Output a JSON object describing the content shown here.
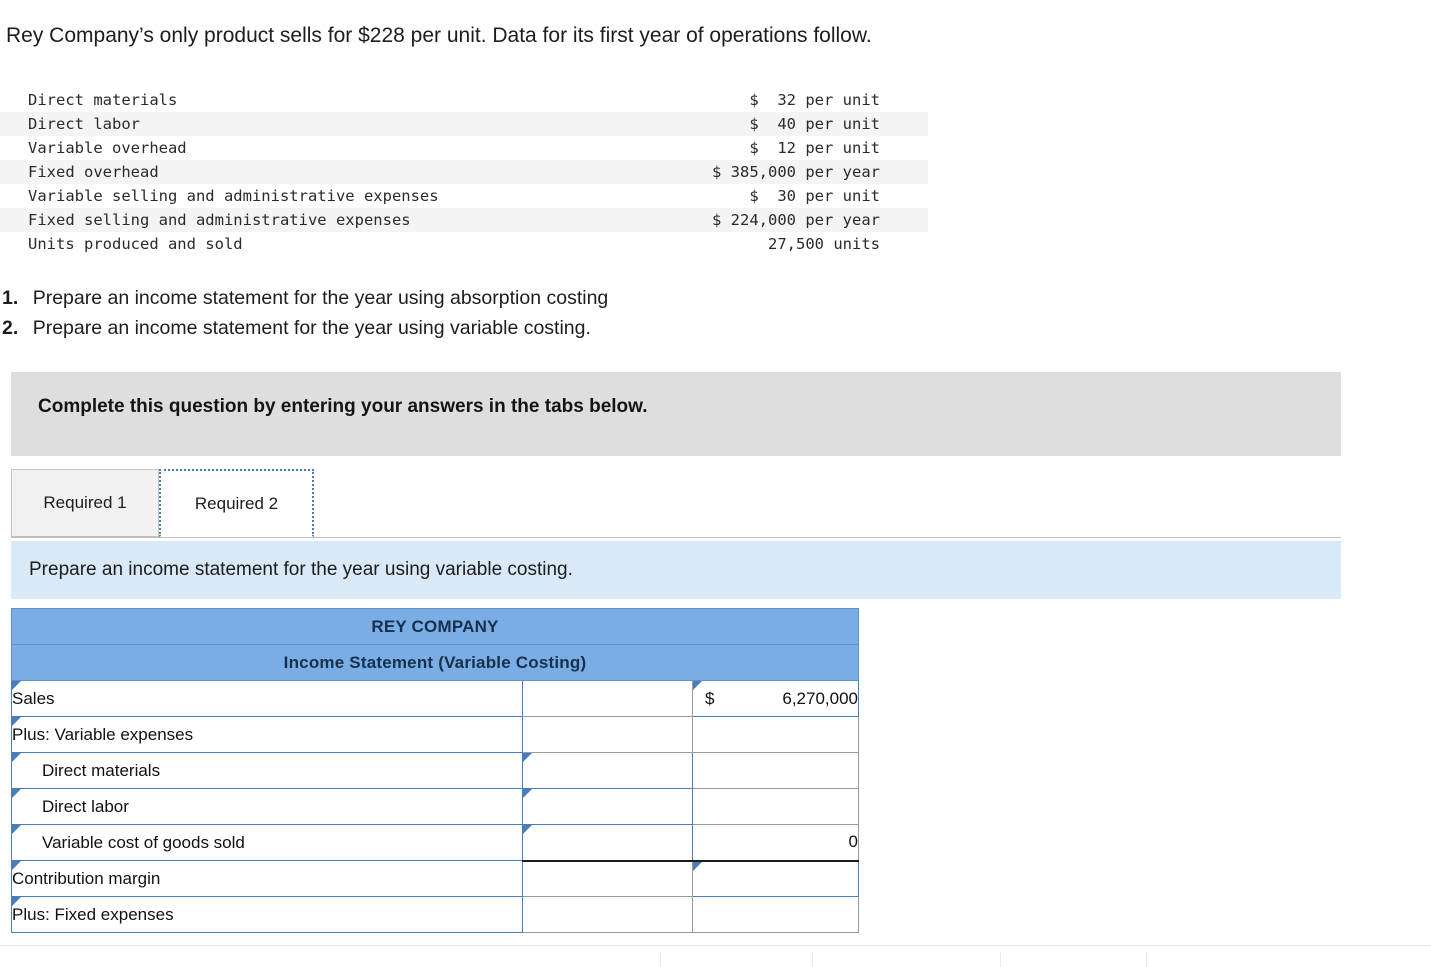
{
  "intro": {
    "text": "Rey Company’s only product sells for $228 per unit. Data for its first year of operations follow."
  },
  "given_data": {
    "rows": [
      {
        "label": "Direct materials",
        "value": "$  32 per unit"
      },
      {
        "label": "Direct labor",
        "value": "$  40 per unit"
      },
      {
        "label": "Variable overhead",
        "value": "$  12 per unit"
      },
      {
        "label": "Fixed overhead",
        "value": "$ 385,000 per year"
      },
      {
        "label": "Variable selling and administrative expenses",
        "value": "$  30 per unit"
      },
      {
        "label": "Fixed selling and administrative expenses",
        "value": "$ 224,000 per year"
      },
      {
        "label": "Units produced and sold",
        "value": "27,500 units"
      }
    ]
  },
  "requirements": [
    {
      "num": "1.",
      "text": "Prepare an income statement for the year using absorption costing"
    },
    {
      "num": "2.",
      "text": "Prepare an income statement for the year using variable costing."
    }
  ],
  "gray_banner": {
    "text": "Complete this question by entering your answers in the tabs below."
  },
  "tabs": [
    {
      "label": "Required 1",
      "active": false
    },
    {
      "label": "Required 2",
      "active": true
    }
  ],
  "blue_bar": {
    "text": "Prepare an income statement for the year using variable costing."
  },
  "worksheet": {
    "company": "REY COMPANY",
    "statement_title": "Income Statement (Variable Costing)",
    "rows": [
      {
        "label": "Sales",
        "indent": false,
        "mid": "",
        "right": "6,270,000",
        "right_symbol": "$",
        "mid_editable": false,
        "right_editable": true,
        "rule": false
      },
      {
        "label": "Plus: Variable expenses",
        "indent": false,
        "mid": "",
        "right": "",
        "right_symbol": "",
        "mid_editable": false,
        "right_editable": false,
        "rule": false
      },
      {
        "label": "Direct materials",
        "indent": true,
        "mid": "",
        "right": "",
        "right_symbol": "",
        "mid_editable": true,
        "right_editable": false,
        "rule": false
      },
      {
        "label": "Direct labor",
        "indent": true,
        "mid": "",
        "right": "",
        "right_symbol": "",
        "mid_editable": true,
        "right_editable": false,
        "rule": false
      },
      {
        "label": "Variable cost of goods sold",
        "indent": true,
        "mid": "",
        "right": "0",
        "right_symbol": "",
        "mid_editable": true,
        "right_editable": false,
        "rule": false
      },
      {
        "label": "Contribution margin",
        "indent": false,
        "mid": "",
        "right": "",
        "right_symbol": "",
        "mid_editable": false,
        "right_editable": true,
        "rule": true
      },
      {
        "label": "Plus: Fixed expenses",
        "indent": false,
        "mid": "",
        "right": "",
        "right_symbol": "",
        "mid_editable": false,
        "right_editable": false,
        "rule": false
      }
    ]
  },
  "colors": {
    "header_blue": "#7aade4",
    "banner_gray": "#dedede",
    "instruction_blue": "#d9e9f8",
    "cell_border_blue": "#4a7ebb",
    "tab_inactive": "#f1f1f1"
  }
}
